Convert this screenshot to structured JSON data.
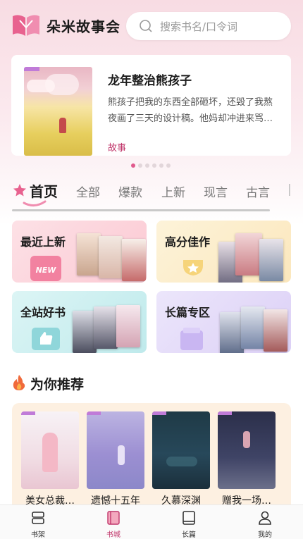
{
  "app": {
    "title": "朵米故事会"
  },
  "search": {
    "placeholder": "搜索书名/口令词"
  },
  "banner": {
    "title": "龙年整治熊孩子",
    "description": "熊孩子把我的东西全部砸坏，还毁了我熬夜画了三天的设计稿。他妈却冲进来骂…",
    "tag": "故事",
    "page_count": 6,
    "active_page": 1
  },
  "tabs": {
    "home": "首页",
    "items": [
      "全部",
      "爆款",
      "上新",
      "现言",
      "古言"
    ]
  },
  "categories": [
    {
      "label": "最近上新",
      "badge": "NEW"
    },
    {
      "label": "高分佳作",
      "badge": ""
    },
    {
      "label": "全站好书",
      "badge": ""
    },
    {
      "label": "长篇专区",
      "badge": ""
    }
  ],
  "recommend": {
    "heading": "为你推荐",
    "books": [
      {
        "title": "美女总裁…"
      },
      {
        "title": "遗憾十五年"
      },
      {
        "title": "久慕深渊"
      },
      {
        "title": "赠我一场…"
      }
    ]
  },
  "nav": {
    "items": [
      {
        "label": "书架",
        "icon": "bookshelf-icon"
      },
      {
        "label": "书城",
        "icon": "bookstore-icon",
        "active": true
      },
      {
        "label": "长篇",
        "icon": "book-icon"
      },
      {
        "label": "我的",
        "icon": "profile-icon"
      }
    ]
  },
  "colors": {
    "accent": "#c0356a",
    "dot_active": "#e05a8d",
    "banner_tag": "#c0356a"
  }
}
